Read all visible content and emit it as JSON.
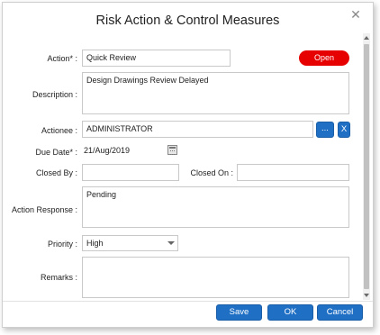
{
  "dialog": {
    "title": "Risk Action & Control Measures",
    "close_icon": "close-icon"
  },
  "form": {
    "action_label": "Action* :",
    "action_value": "Quick Review",
    "status_label": "Open",
    "description_label": "Description :",
    "description_value": "Design Drawings Review Delayed",
    "actionee_label": "Actionee :",
    "actionee_value": "ADMINISTRATOR",
    "browse_label": "...",
    "clear_label": "X",
    "due_date_label": "Due Date* :",
    "due_date_value": "21/Aug/2019",
    "closed_by_label": "Closed By :",
    "closed_by_value": "",
    "closed_on_label": "Closed On :",
    "closed_on_value": "",
    "action_response_label": "Action Response :",
    "action_response_value": "Pending",
    "priority_label": "Priority :",
    "priority_value": "High",
    "remarks_label": "Remarks :",
    "remarks_value": ""
  },
  "footer": {
    "save_label": "Save",
    "ok_label": "OK",
    "cancel_label": "Cancel"
  },
  "colors": {
    "status_open": "#e60000",
    "primary_button": "#1f6fc5"
  }
}
